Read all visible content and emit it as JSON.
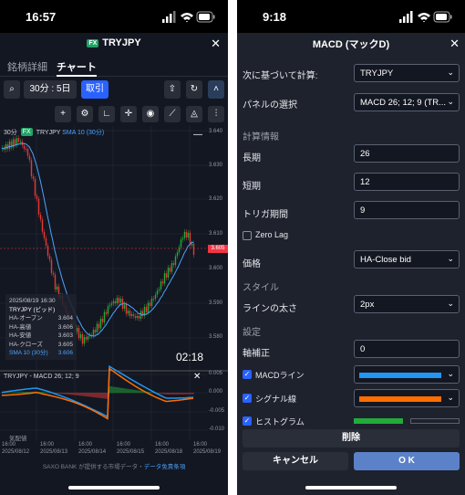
{
  "left": {
    "status_time": "16:57",
    "title": "TRYJPY",
    "fx_badge": "FX",
    "tabs": [
      "銘柄詳細",
      "チャート"
    ],
    "timeframe": "30分 : 5日",
    "trade_button": "取引",
    "legend_interval": "30分",
    "legend_fx": "FX",
    "legend_symbol": "TRYJPY",
    "legend_sma": "SMA 10 (30分)",
    "macd_legend": "TRYJPY - MACD 26; 12; 9",
    "price_axis": [
      "3.640",
      "3.630",
      "3.620",
      "3.610",
      "3.600",
      "3.590",
      "3.580"
    ],
    "current_price": "3.605",
    "macd_axis": [
      "0.005",
      "0.000",
      "-0.005",
      "-0.010"
    ],
    "dates": [
      "16:00",
      "16:00",
      "16:00",
      "16:00",
      "16:00",
      "16:00"
    ],
    "date_labels": [
      "2025/08/12",
      "2025/08/13",
      "2025/08/14",
      "2025/08/15",
      "2025/08/18",
      "2025/08/19"
    ],
    "watermark": "気配値",
    "countdown": "02:18",
    "info": {
      "timestamp": "2025/08/19 16:30",
      "name": "TRYJPY (ビッド)",
      "rows": [
        {
          "label": "HA-オープン",
          "value": "3.604"
        },
        {
          "label": "HA-高値",
          "value": "3.606"
        },
        {
          "label": "HA-安値",
          "value": "3.603"
        },
        {
          "label": "HA-クローズ",
          "value": "3.605"
        },
        {
          "label": "SMA 10 (30分)",
          "value": "3.606"
        }
      ]
    },
    "footer_text": "SAXO BANK が提供する市場データ・",
    "footer_link": "データ免責条項"
  },
  "right": {
    "status_time": "9:18",
    "title": "MACD (マックD)",
    "calc_label": "次に基づいて計算:",
    "calc_value": "TRYJPY",
    "panel_label": "パネルの選択",
    "panel_value": "MACD 26; 12; 9 (TR...",
    "section_calc": "計算情報",
    "long_label": "長期",
    "long_value": "26",
    "short_label": "短期",
    "short_value": "12",
    "trigger_label": "トリガ期間",
    "trigger_value": "9",
    "zerolag_label": "Zero Lag",
    "price_label": "価格",
    "price_value": "HA-Close bid",
    "section_style": "スタイル",
    "linewidth_label": "ラインの太さ",
    "linewidth_value": "2px",
    "section_settings": "設定",
    "axis_label": "軸補正",
    "axis_value": "0",
    "macd_line_label": "MACDライン",
    "signal_label": "シグナル線",
    "histogram_label": "ヒストグラム",
    "delete_label": "削除",
    "cancel_label": "キャンセル",
    "ok_label": "O K",
    "colors": {
      "macd": "#2196f3",
      "signal": "#ff6d00",
      "hist_up": "#22ab3a",
      "hist_down": "#e53935"
    }
  }
}
